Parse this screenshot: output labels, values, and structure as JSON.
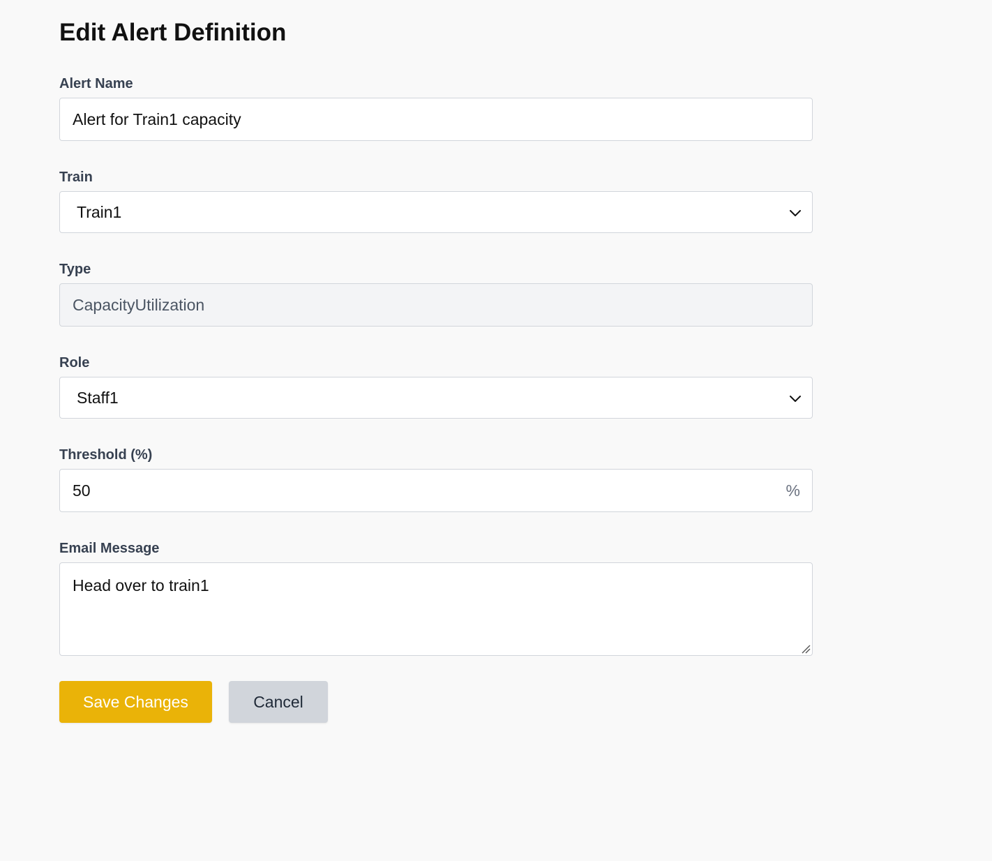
{
  "page": {
    "title": "Edit Alert Definition"
  },
  "form": {
    "alert_name": {
      "label": "Alert Name",
      "value": "Alert for Train1 capacity"
    },
    "train": {
      "label": "Train",
      "selected": "Train1",
      "icon": "chevron-down-icon"
    },
    "type": {
      "label": "Type",
      "value": "CapacityUtilization",
      "readonly": true
    },
    "role": {
      "label": "Role",
      "selected": "Staff1",
      "icon": "chevron-down-icon"
    },
    "threshold": {
      "label": "Threshold (%)",
      "value": "50",
      "suffix": "%"
    },
    "email_message": {
      "label": "Email Message",
      "value": "Head over to train1"
    }
  },
  "actions": {
    "save_label": "Save Changes",
    "cancel_label": "Cancel"
  },
  "colors": {
    "background": "#f9f9f9",
    "primary": "#eab308",
    "secondary": "#d1d5db",
    "readonly_bg": "#f3f4f6",
    "border": "#d1d5db"
  }
}
